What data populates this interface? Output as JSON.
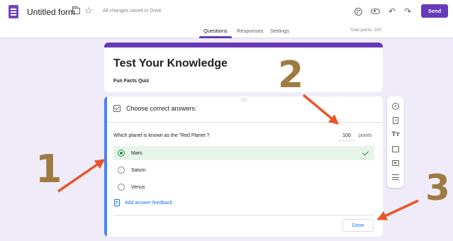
{
  "topbar": {
    "title": "Untitled form",
    "saved_status": "All changes saved in Drive",
    "send_label": "Send",
    "icons": [
      "forms-app-icon",
      "folder-icon",
      "star-icon",
      "palette-icon",
      "eye-icon",
      "undo-icon",
      "redo-icon",
      "more-vert-icon"
    ]
  },
  "tabs": {
    "items": [
      {
        "label": "Questions",
        "active": true
      },
      {
        "label": "Responses",
        "active": false
      },
      {
        "label": "Settings",
        "active": false
      }
    ],
    "total_points": "Total points: 100"
  },
  "title_card": {
    "title": "Test Your Knowledge",
    "description": "Fun Facts Quiz"
  },
  "question_card": {
    "choose_answers_label": "Choose correct answers:",
    "question_text": "Which planet is known as the \"Red Planet ?",
    "points_value": "100",
    "points_label": "points",
    "options": [
      {
        "label": "Mars",
        "correct": true
      },
      {
        "label": "Saturn",
        "correct": false
      },
      {
        "label": "Venus",
        "correct": false
      }
    ],
    "feedback_link": "Add answer feedback",
    "done_label": "Done"
  },
  "side_toolbar": {
    "icons": [
      "add-question-icon",
      "import-questions-icon",
      "add-title-icon",
      "add-image-icon",
      "add-video-icon",
      "add-section-icon"
    ]
  },
  "annotations": {
    "numbers": [
      "1",
      "2",
      "3"
    ],
    "arrow_color": "#e8562a",
    "number_color": "#9e7b42"
  },
  "colors": {
    "accent": "#673ab7",
    "background": "#f0ebf8",
    "correct_green": "#1e8e3e",
    "link_blue": "#1a73e8"
  }
}
